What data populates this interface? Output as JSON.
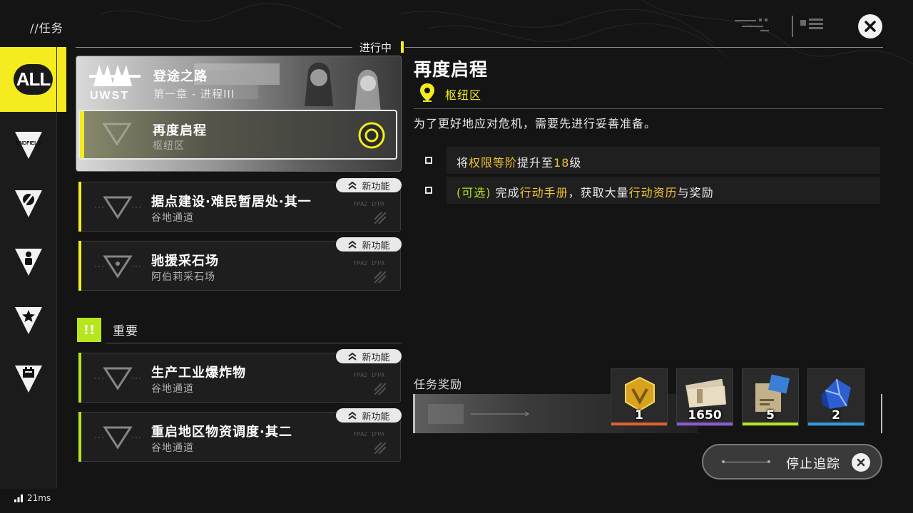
{
  "header": {
    "title": "//任务"
  },
  "nav": {
    "all_label": "ALL",
    "items": [
      {
        "name": "endfield",
        "icon": "endfield-icon",
        "label": "ENDFIELD"
      },
      {
        "name": "exploration",
        "icon": "compass-icon"
      },
      {
        "name": "character",
        "icon": "person-icon"
      },
      {
        "name": "favorite",
        "icon": "star-icon"
      },
      {
        "name": "facility",
        "icon": "battery-icon"
      }
    ]
  },
  "tracking": {
    "label": "进行中"
  },
  "chapter": {
    "logo_text": "UWST",
    "title": "登途之路",
    "subtitle": "第一章 - 进程III"
  },
  "quests": {
    "active": {
      "title": "再度启程",
      "location": "枢纽区"
    },
    "list": [
      {
        "title": "据点建设·难民暂居处·其一",
        "location": "谷地通道",
        "badge": "新功能",
        "code": "FPA2 1FPA"
      },
      {
        "title": "驰援采石场",
        "location": "阿伯莉采石场",
        "badge": "新功能",
        "code": "FPA2 1FPA"
      }
    ],
    "important_label": "重要",
    "important_icon_text": "!!",
    "important": [
      {
        "title": "生产工业爆炸物",
        "location": "谷地通道",
        "badge": "新功能",
        "code": "FPA2 1FPA"
      },
      {
        "title": "重启地区物资调度·其二",
        "location": "谷地通道",
        "badge": "新功能",
        "code": "FPA2 1FPA"
      }
    ]
  },
  "detail": {
    "title": "再度启程",
    "location": "枢纽区",
    "description": "为了更好地应对危机，需要先进行妥善准备。",
    "objectives": [
      {
        "parts": [
          {
            "t": "将",
            "c": ""
          },
          {
            "t": "权限等阶",
            "c": "hl"
          },
          {
            "t": "提升至",
            "c": ""
          },
          {
            "t": "18",
            "c": "hl"
          },
          {
            "t": "级",
            "c": ""
          }
        ]
      },
      {
        "parts": [
          {
            "t": "(可选) ",
            "c": "opt"
          },
          {
            "t": "完成",
            "c": ""
          },
          {
            "t": "行动手册",
            "c": "hl"
          },
          {
            "t": "，获取大量",
            "c": ""
          },
          {
            "t": "行动资历",
            "c": "hl"
          },
          {
            "t": "与奖励",
            "c": ""
          }
        ]
      }
    ]
  },
  "rewards": {
    "label": "任务奖励",
    "items": [
      {
        "name": "gold-badge",
        "count": "1",
        "rarity_color": "#e0622a"
      },
      {
        "name": "cash-bundle",
        "count": "1650",
        "rarity_color": "#8a5bd6"
      },
      {
        "name": "exp-record",
        "count": "5",
        "rarity_color": "#b5e61e"
      },
      {
        "name": "blue-crystal",
        "count": "2",
        "rarity_color": "#2f9be0"
      }
    ]
  },
  "footer": {
    "stop_label": "停止追踪",
    "ping": "21ms"
  },
  "colors": {
    "accent": "#f4ec1e",
    "important": "#b5e61e",
    "highlight": "#f1c232"
  }
}
